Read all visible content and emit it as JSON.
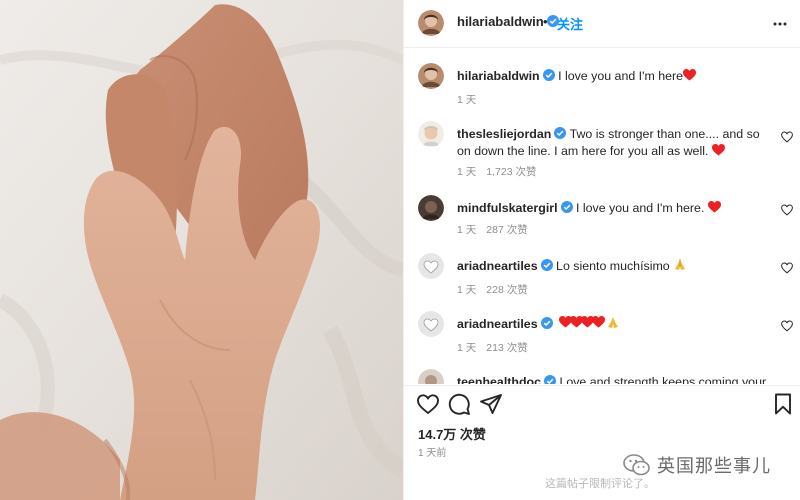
{
  "post": {
    "author": "hilariabaldwin",
    "follow_label": "关注",
    "separator": "•"
  },
  "comments": [
    {
      "user": "hilariabaldwin",
      "text": "I love you and I'm here",
      "emoji": "heart",
      "time": "1 天",
      "likes": ""
    },
    {
      "user": "theslesliejordan",
      "text": "Two is stronger than one.... and so on down the line. I am here for you all as well.",
      "emoji": "heart",
      "time": "1 天",
      "likes": "1,723 次赞"
    },
    {
      "user": "mindfulskatergirl",
      "text": "I love you and I'm here.",
      "emoji": "heart",
      "time": "1 天",
      "likes": "287 次赞"
    },
    {
      "user": "ariadneartiles",
      "text": "Lo siento muchísimo",
      "emoji": "pray",
      "time": "1 天",
      "likes": "228 次赞"
    },
    {
      "user": "ariadneartiles",
      "text": "",
      "emoji": "hearts-pray",
      "time": "1 天",
      "likes": "213 次赞"
    },
    {
      "user": "teenhealthdoc",
      "text": "Love and strength keeps coming your way",
      "emoji": "",
      "time": "",
      "likes": ""
    }
  ],
  "actions": {
    "likes_total": "14.7万 次赞",
    "posted": "1 天前"
  },
  "footer": {
    "restricted_note": "这篇帖子限制评论了。",
    "watermark": "英国那些事儿"
  },
  "colors": {
    "link_blue": "#0095f6",
    "verified_blue": "#3897f0",
    "heart_red": "#ed4956",
    "muted_gray": "#8e8e8e"
  },
  "icons": [
    "verified-badge-icon",
    "more-options-icon",
    "heart-icon",
    "comment-icon",
    "share-icon",
    "bookmark-icon",
    "wechat-logo-icon"
  ]
}
